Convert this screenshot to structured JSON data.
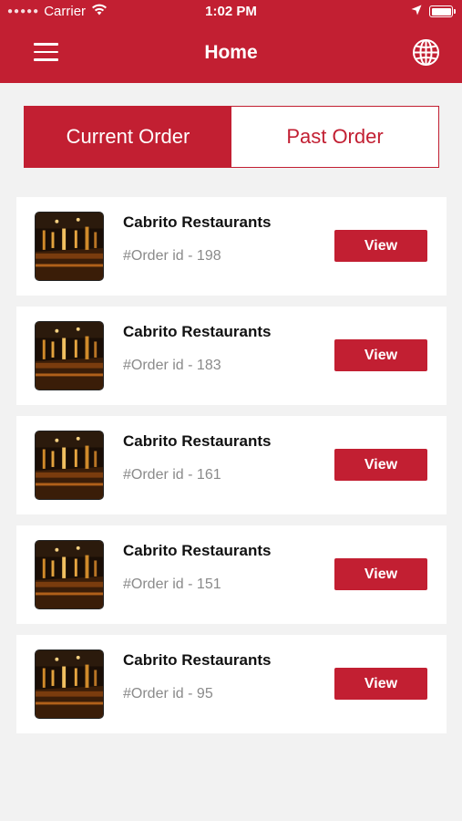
{
  "status_bar": {
    "carrier": "Carrier",
    "time": "1:02 PM"
  },
  "header": {
    "title": "Home",
    "menu_icon": "hamburger-menu-icon",
    "globe_icon": "globe-icon"
  },
  "tabs": [
    {
      "label": "Current Order",
      "active": true
    },
    {
      "label": "Past Order",
      "active": false
    }
  ],
  "orders": [
    {
      "restaurant": "Cabrito Restaurants",
      "order_id": "#Order id - 198",
      "button": "View"
    },
    {
      "restaurant": "Cabrito Restaurants",
      "order_id": "#Order id - 183",
      "button": "View"
    },
    {
      "restaurant": "Cabrito Restaurants",
      "order_id": "#Order id - 161",
      "button": "View"
    },
    {
      "restaurant": "Cabrito Restaurants",
      "order_id": "#Order id - 151",
      "button": "View"
    },
    {
      "restaurant": "Cabrito Restaurants",
      "order_id": "#Order id - 95",
      "button": "View"
    }
  ],
  "colors": {
    "brand": "#c21f32",
    "background": "#f2f2f2",
    "card": "#ffffff",
    "muted_text": "#8a8a8a"
  }
}
